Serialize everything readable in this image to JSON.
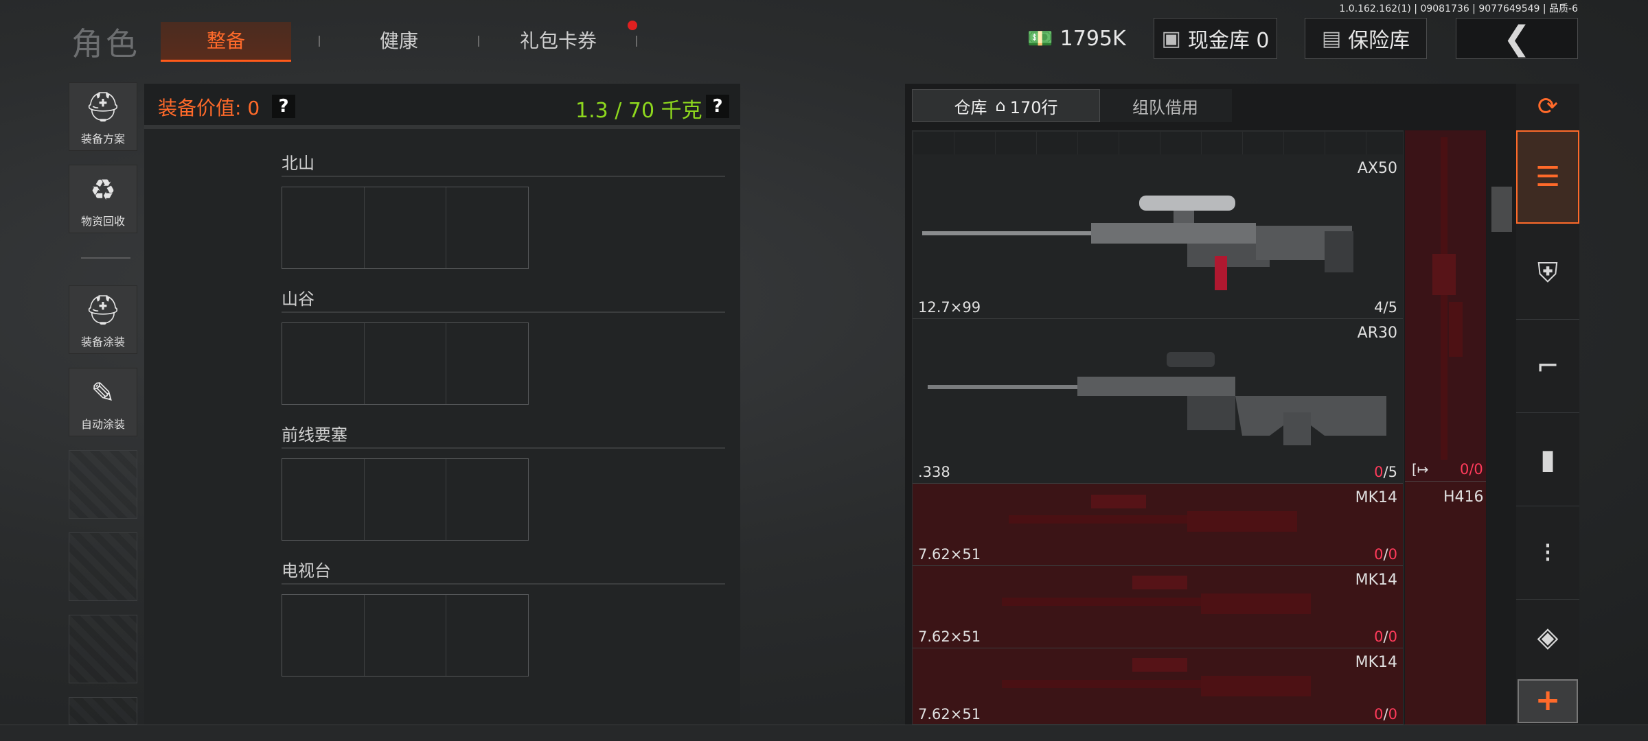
{
  "version": "1.0.162.162(1) | 09081736 | 9077649549 | 品质-6",
  "app_title": "角色",
  "tabs": [
    {
      "label": "整备",
      "active": true
    },
    {
      "label": "健康",
      "active": false
    },
    {
      "label": "礼包卡券",
      "active": false,
      "badge": true
    }
  ],
  "topbar": {
    "currency": "1795K",
    "cash_vault": "现金库 0",
    "safe_vault": "保险库"
  },
  "sidebar": {
    "items": [
      {
        "label": "装备方案",
        "icon": "loadout-icon"
      },
      {
        "label": "物资回收",
        "icon": "recycle-icon"
      },
      {
        "label": "装备涂装",
        "icon": "helmet-paint-icon"
      },
      {
        "label": "自动涂装",
        "icon": "auto-paint-icon"
      }
    ]
  },
  "gear": {
    "value_label": "装备价值: 0",
    "weight_label": "1.3 / 70 千克",
    "help": "?",
    "locations": [
      "北山",
      "山谷",
      "前线要塞",
      "电视台"
    ]
  },
  "warehouse": {
    "tab_active": "仓库",
    "rows": "170行",
    "tab_inactive": "组队借用",
    "items": [
      {
        "name": "AX50",
        "caliber": "12.7×99",
        "count": "4",
        "max": "5"
      },
      {
        "name": "AR30",
        "caliber": ".338",
        "count": "0",
        "max": "5"
      },
      {
        "name": "MK14",
        "caliber": "7.62×51",
        "count": "0",
        "max": "0"
      },
      {
        "name": "MK14",
        "caliber": "7.62×51",
        "count": "0",
        "max": "0"
      },
      {
        "name": "MK14",
        "caliber": "7.62×51",
        "count": "0",
        "max": "0"
      }
    ],
    "side_item": {
      "name": "H416",
      "count": "0/0",
      "link": "[↦"
    }
  },
  "categories": [
    "all-icon",
    "vest-icon",
    "rifle-icon",
    "magazine-icon",
    "ammo-icon",
    "scope-icon"
  ],
  "add_label": "+",
  "colors": {
    "accent": "#ff6a2a",
    "weight": "#8ed81e",
    "zero": "#ff3b5b"
  }
}
